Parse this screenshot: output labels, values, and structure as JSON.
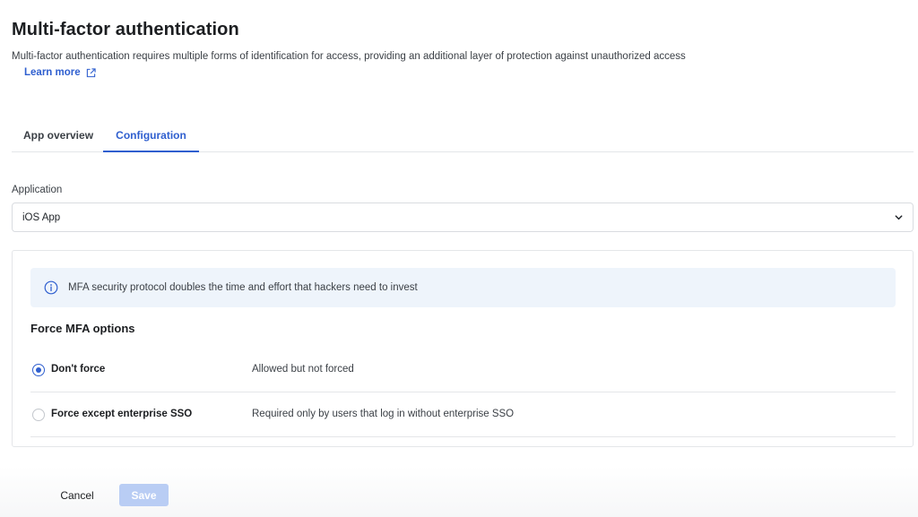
{
  "header": {
    "title": "Multi-factor authentication",
    "subtitle": "Multi-factor authentication requires multiple forms of identification for access, providing an additional layer of protection against unauthorized access",
    "learn_more": "Learn more"
  },
  "tabs": [
    {
      "label": "App overview",
      "active": false
    },
    {
      "label": "Configuration",
      "active": true
    }
  ],
  "application": {
    "label": "Application",
    "value": "iOS App"
  },
  "info_banner": {
    "text": "MFA security protocol doubles the time and effort that hackers need to invest"
  },
  "force_mfa": {
    "title": "Force MFA options",
    "options": [
      {
        "label": "Don't force",
        "description": "Allowed but not forced",
        "selected": true
      },
      {
        "label": "Force except enterprise SSO",
        "description": "Required only by users that log in without enterprise SSO",
        "selected": false
      }
    ]
  },
  "footer": {
    "cancel_label": "Cancel",
    "save_label": "Save"
  },
  "colors": {
    "accent": "#2f5fcf",
    "info_bg": "#eef4fb",
    "save_disabled": "#b9cdf4"
  }
}
